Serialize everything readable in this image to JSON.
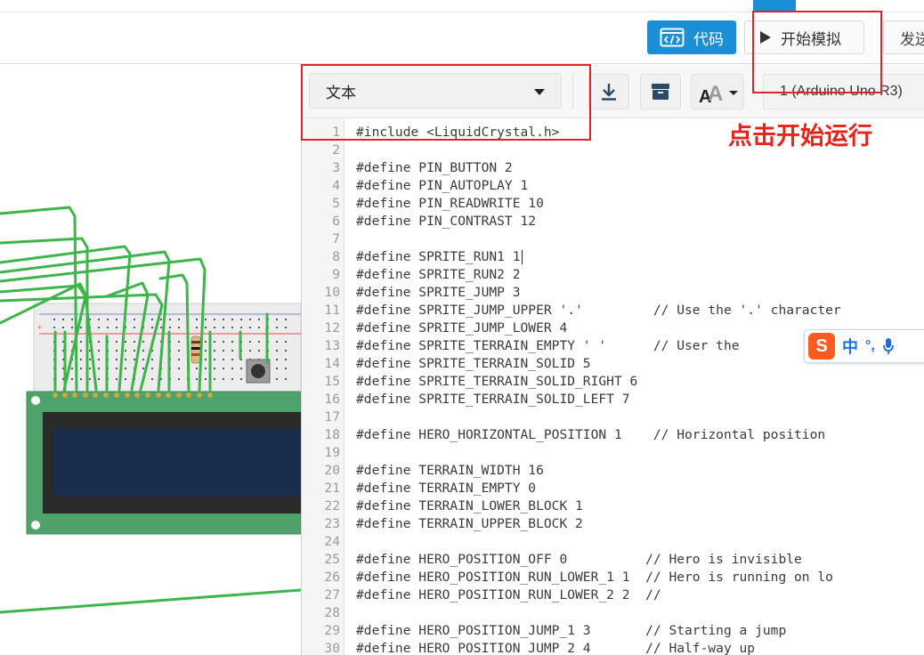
{
  "toolbar": {
    "code_label": "代码",
    "start_sim_label": "开始模拟",
    "send_label": "发送"
  },
  "editor": {
    "mode": "文本",
    "device": "1 (Arduino Uno R3)"
  },
  "annotation": "点击开始运行",
  "ime": {
    "mode_char": "中",
    "punct": "°,"
  },
  "code_lines": [
    {
      "n": "1",
      "t": "#include <LiquidCrystal.h>"
    },
    {
      "n": "2",
      "t": ""
    },
    {
      "n": "3",
      "t": "#define PIN_BUTTON 2"
    },
    {
      "n": "4",
      "t": "#define PIN_AUTOPLAY 1"
    },
    {
      "n": "5",
      "t": "#define PIN_READWRITE 10"
    },
    {
      "n": "6",
      "t": "#define PIN_CONTRAST 12"
    },
    {
      "n": "7",
      "t": ""
    },
    {
      "n": "8",
      "t": "#define SPRITE_RUN1 1"
    },
    {
      "n": "9",
      "t": "#define SPRITE_RUN2 2"
    },
    {
      "n": "10",
      "t": "#define SPRITE_JUMP 3"
    },
    {
      "n": "11",
      "t": "#define SPRITE_JUMP_UPPER '.'         // Use the '.' character"
    },
    {
      "n": "12",
      "t": "#define SPRITE_JUMP_LOWER 4"
    },
    {
      "n": "13",
      "t": "#define SPRITE_TERRAIN_EMPTY ' '      // User the"
    },
    {
      "n": "14",
      "t": "#define SPRITE_TERRAIN_SOLID 5"
    },
    {
      "n": "15",
      "t": "#define SPRITE_TERRAIN_SOLID_RIGHT 6"
    },
    {
      "n": "16",
      "t": "#define SPRITE_TERRAIN_SOLID_LEFT 7"
    },
    {
      "n": "17",
      "t": ""
    },
    {
      "n": "18",
      "t": "#define HERO_HORIZONTAL_POSITION 1    // Horizontal position"
    },
    {
      "n": "19",
      "t": ""
    },
    {
      "n": "20",
      "t": "#define TERRAIN_WIDTH 16"
    },
    {
      "n": "21",
      "t": "#define TERRAIN_EMPTY 0"
    },
    {
      "n": "22",
      "t": "#define TERRAIN_LOWER_BLOCK 1"
    },
    {
      "n": "23",
      "t": "#define TERRAIN_UPPER_BLOCK 2"
    },
    {
      "n": "24",
      "t": ""
    },
    {
      "n": "25",
      "t": "#define HERO_POSITION_OFF 0          // Hero is invisible"
    },
    {
      "n": "26",
      "t": "#define HERO_POSITION_RUN_LOWER_1 1  // Hero is running on lo"
    },
    {
      "n": "27",
      "t": "#define HERO_POSITION_RUN_LOWER_2 2  //"
    },
    {
      "n": "28",
      "t": ""
    },
    {
      "n": "29",
      "t": "#define HERO_POSITION_JUMP_1 3       // Starting a jump"
    },
    {
      "n": "30",
      "t": "#define HERO_POSITION_JUMP_2 4       // Half-way up"
    }
  ]
}
